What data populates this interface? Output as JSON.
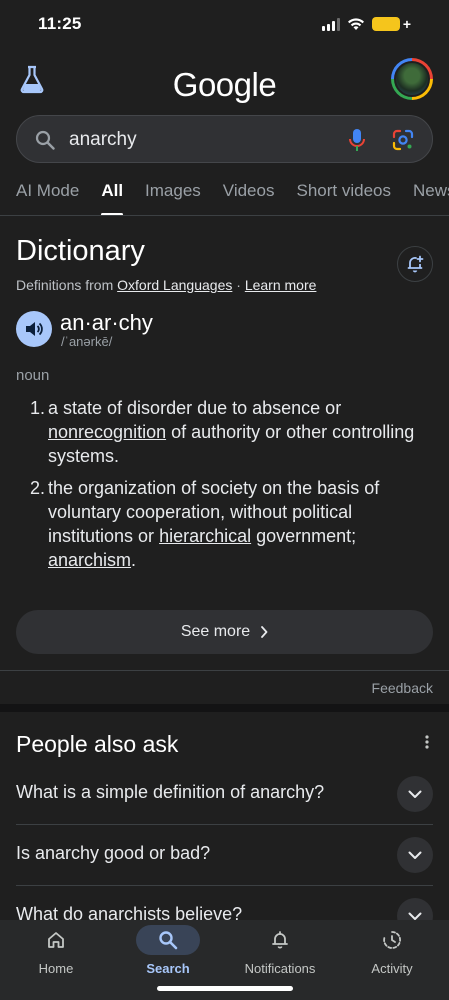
{
  "status_bar": {
    "time": "11:25"
  },
  "header": {
    "logo_text": "Google"
  },
  "search": {
    "query": "anarchy"
  },
  "tabs": [
    {
      "label": "AI Mode"
    },
    {
      "label": "All"
    },
    {
      "label": "Images"
    },
    {
      "label": "Videos"
    },
    {
      "label": "Short videos"
    },
    {
      "label": "News"
    }
  ],
  "dictionary": {
    "title": "Dictionary",
    "source_prefix": "Definitions from ",
    "source_link": "Oxford Languages",
    "source_sep": " · ",
    "learn_more": "Learn more",
    "word": "an·ar·chy",
    "phonetic": "/ˈanərkē/",
    "part_of_speech": "noun",
    "definitions": [
      {
        "num": "1.",
        "a": "a state of disorder due to absence or ",
        "link1": "nonrecognition",
        "b": " of authority or other controlling systems."
      },
      {
        "num": "2.",
        "a": "the organization of society on the basis of voluntary cooperation, without political institutions or ",
        "link1": "hierarchical",
        "b": " government; ",
        "link2": "anarchism",
        "c": "."
      }
    ],
    "see_more": "See more",
    "feedback": "Feedback"
  },
  "people_also_ask": {
    "title": "People also ask",
    "questions": [
      "What is a simple definition of anarchy?",
      "Is anarchy good or bad?",
      "What do anarchists believe?"
    ]
  },
  "bottom_nav": [
    {
      "label": "Home",
      "icon": "home-icon"
    },
    {
      "label": "Search",
      "icon": "search-icon",
      "active": true
    },
    {
      "label": "Notifications",
      "icon": "bell-icon"
    },
    {
      "label": "Activity",
      "icon": "activity-icon"
    }
  ],
  "colors": {
    "background": "#1f1f1f",
    "accent_blue": "#a8c7fa",
    "battery": "#f5c51c"
  }
}
